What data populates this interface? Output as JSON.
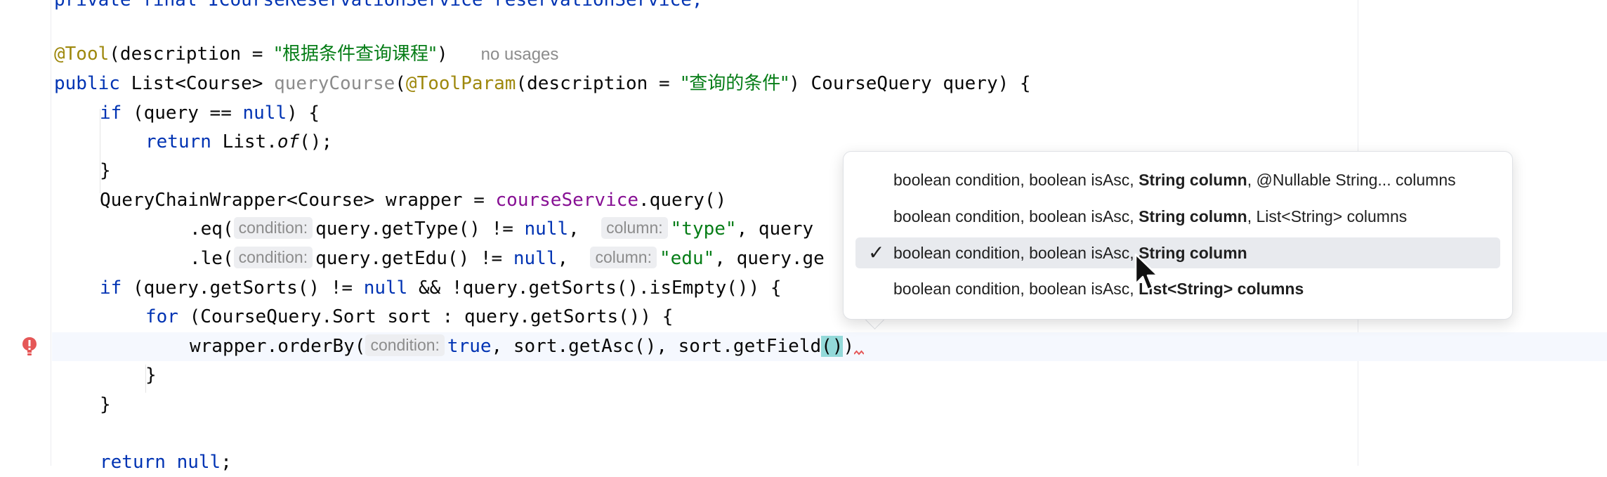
{
  "editor": {
    "lines": {
      "l0": {
        "text": "private final ICourseReservationService reservationService;"
      },
      "l2": {
        "annotation": "@Tool",
        "pre": "(description = ",
        "string": "\"根据条件查询课程\"",
        "post": ")",
        "usages": "no usages"
      },
      "l3": {
        "kw": "public",
        "type": " List<Course> ",
        "method": "queryCourse",
        "open": "(",
        "annotation": "@ToolParam",
        "pre": "(description = ",
        "string": "\"查询的条件\"",
        "post": ") CourseQuery query) {"
      },
      "l4": {
        "kw": "if",
        "pre": " (query == ",
        "kw2": "null",
        "post": ") {"
      },
      "l5": {
        "kw": "return",
        "pre": " List.",
        "italic": "of",
        "post": "();"
      },
      "l6": {
        "text": "}"
      },
      "l7": {
        "pre": "QueryChainWrapper<Course> wrapper = ",
        "field": "courseService",
        "post": ".query()"
      },
      "l8": {
        "pre": ".eq(",
        "hint1": "condition:",
        "mid": "query.getType() != ",
        "kw": "null",
        "sep": ", ",
        "hint2": "column:",
        "string": "\"type\"",
        "post": ", query"
      },
      "l9": {
        "pre": ".le(",
        "hint1": "condition:",
        "mid": "query.getEdu() != ",
        "kw": "null",
        "sep": ", ",
        "hint2": "column:",
        "string": "\"edu\"",
        "post": ", query.ge"
      },
      "l10": {
        "kw": "if",
        "pre": " (query.getSorts() != ",
        "kw2": "null",
        "post": " && !query.getSorts().isEmpty()) {"
      },
      "l11": {
        "kw": "for",
        "post": " (CourseQuery.Sort sort : query.getSorts()) {"
      },
      "l12": {
        "pre": "wrapper.orderBy(",
        "hint": "condition:",
        "kw": "true",
        "mid": ", sort.getAsc(), sort.getField",
        "paren": "()",
        "post": ")"
      },
      "l13": {
        "text": "}"
      },
      "l14": {
        "text": "}"
      },
      "l16": {
        "kw": "return",
        "kw2": "null",
        "post": ";"
      }
    }
  },
  "popup": {
    "items": [
      {
        "prefix": "boolean condition, boolean isAsc, ",
        "bold": "String column",
        "suffix": ", @Nullable String... columns"
      },
      {
        "prefix": "boolean condition, boolean isAsc, ",
        "bold": "String column",
        "suffix": ", List<String> columns"
      },
      {
        "prefix": "boolean condition, boolean isAsc, ",
        "bold": "String column",
        "suffix": "",
        "check": "✓"
      },
      {
        "prefix": "boolean condition, boolean isAsc, ",
        "bold": "List<String> columns",
        "suffix": ""
      }
    ]
  },
  "colors": {
    "keyword": "#0033b3",
    "string": "#067d17",
    "annotation": "#9e880d",
    "field": "#871094",
    "error": "#e55757"
  }
}
